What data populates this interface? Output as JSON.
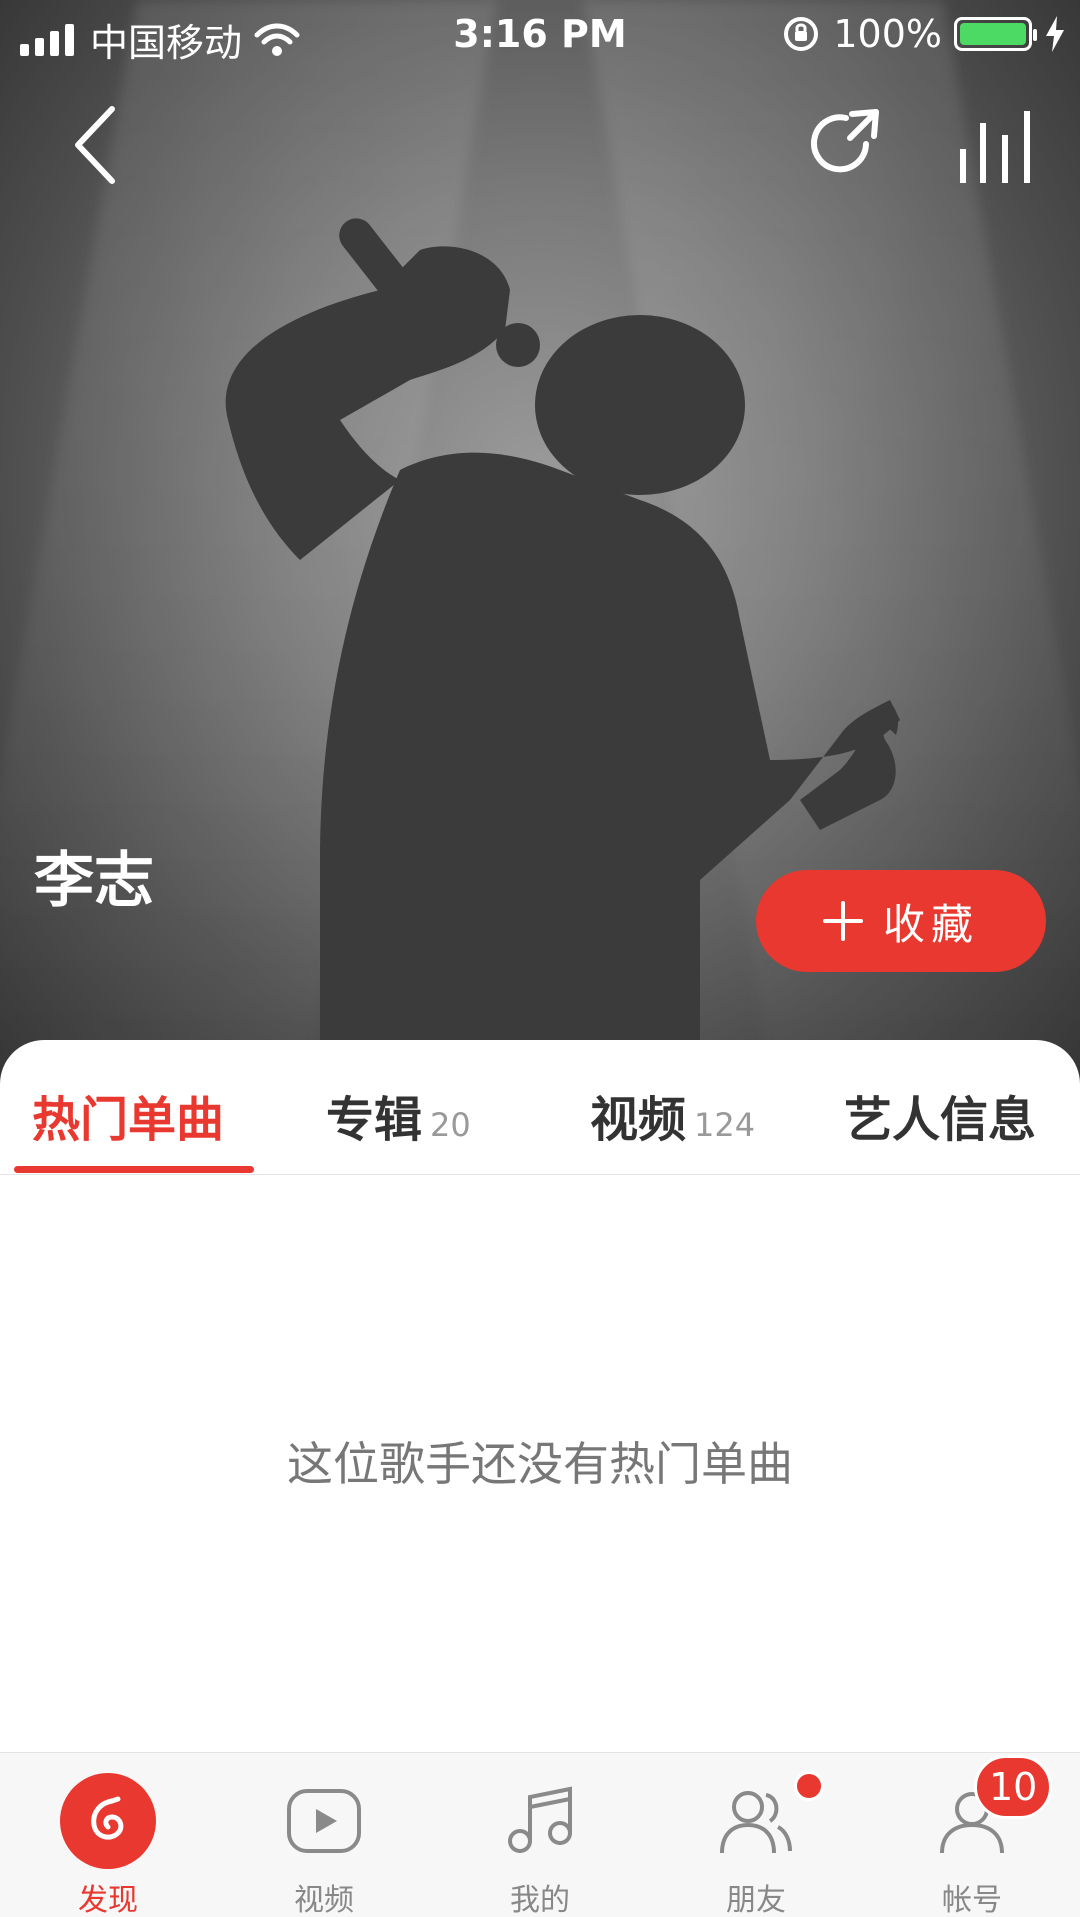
{
  "status_bar": {
    "carrier": "中国移动",
    "time": "3:16 PM",
    "battery_percent": "100%",
    "battery_level": 1.0,
    "battery_color": "#4cd964"
  },
  "header": {
    "back_icon": "chevron-left-icon",
    "share_icon": "share-icon",
    "playing_icon": "equalizer-icon"
  },
  "artist": {
    "name": "李志",
    "follow_button_label": "收藏",
    "follow_icon": "plus-icon"
  },
  "tabs": [
    {
      "label": "热门单曲",
      "count": "",
      "active": true
    },
    {
      "label": "专辑",
      "count": "20",
      "active": false
    },
    {
      "label": "视频",
      "count": "124",
      "active": false
    },
    {
      "label": "艺人信息",
      "count": "",
      "active": false
    }
  ],
  "content": {
    "empty_message": "这位歌手还没有热门单曲"
  },
  "bottom_nav": [
    {
      "label": "发现",
      "icon": "discover-icon",
      "active": true
    },
    {
      "label": "视频",
      "icon": "video-play-icon",
      "active": false
    },
    {
      "label": "我的",
      "icon": "music-note-icon",
      "active": false
    },
    {
      "label": "朋友",
      "icon": "friends-icon",
      "active": false,
      "dot": true
    },
    {
      "label": "帐号",
      "icon": "account-icon",
      "active": false,
      "badge": "10"
    }
  ],
  "colors": {
    "accent": "#e8382f",
    "tab_inactive": "#333333",
    "muted": "#999999"
  }
}
